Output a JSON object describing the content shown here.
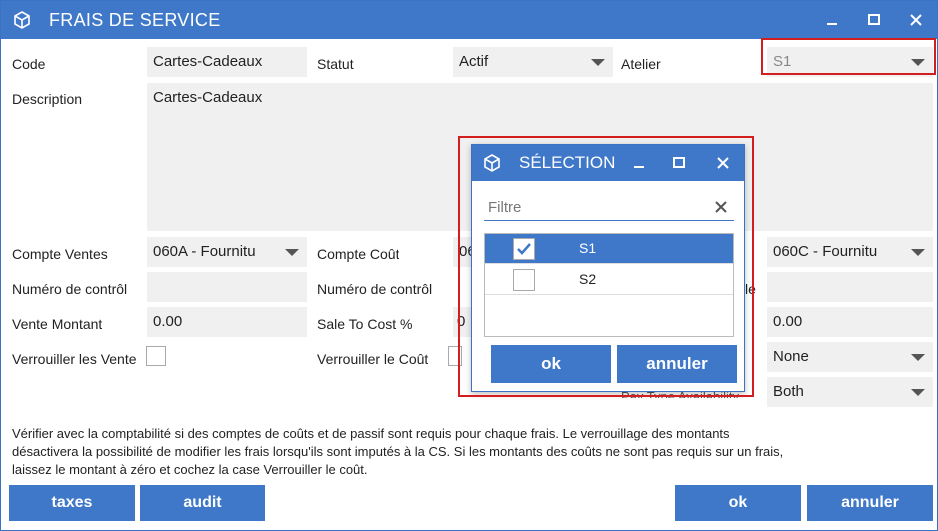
{
  "window": {
    "title": "FRAIS DE SERVICE"
  },
  "form": {
    "code_label": "Code",
    "code_value": "Cartes-Cadeaux",
    "statut_label": "Statut",
    "statut_value": "Actif",
    "atelier_label": "Atelier",
    "atelier_value": "S1",
    "description_label": "Description",
    "description_value": "Cartes-Cadeaux",
    "compte_ventes_label": "Compte Ventes",
    "compte_ventes_value": "060A - Fournitu",
    "compte_cout_label": "Compte Coût",
    "compte_cout_value": "06",
    "compte_passif_value": "060C - Fournitu",
    "numero_controle_ventes_label": "Numéro de contrôl",
    "numero_controle_cout_label": "Numéro de contrôl",
    "numero_controle_passif_label_partial": "le",
    "vente_montant_label": "Vente Montant",
    "vente_montant_value": "0.00",
    "sale_to_cost_label": "Sale To Cost %",
    "sale_to_cost_value": "0",
    "passif_montant_value": "0.00",
    "verrouiller_ventes_label": "Verrouiller les Vente",
    "verrouiller_cout_label": "Verrouiller le Coût",
    "tax_select_value": "None",
    "pay_type_label": "Pay Type Availability",
    "pay_type_value": "Both"
  },
  "note": "Vérifier avec la comptabilité si des comptes de coûts et de passif sont requis pour chaque frais. Le verrouillage des montants désactivera la possibilité de modifier les frais lorsqu'ils sont imputés à la CS. Si les montants des coûts ne sont pas requis sur un frais, laissez le montant à zéro et cochez la case Verrouiller le coût.",
  "buttons": {
    "taxes": "taxes",
    "audit": "audit",
    "ok": "ok",
    "annuler": "annuler"
  },
  "dialog": {
    "title": "SÉLECTION",
    "filter_placeholder": "Filtre",
    "items": [
      {
        "label": "S1",
        "checked": true
      },
      {
        "label": "S2",
        "checked": false
      }
    ],
    "ok_label": "ok",
    "annuler_label": "annuler"
  },
  "colors": {
    "accent": "#3f78c9",
    "highlight_box": "#d21e1e",
    "field_bg": "#f0f0f0"
  }
}
